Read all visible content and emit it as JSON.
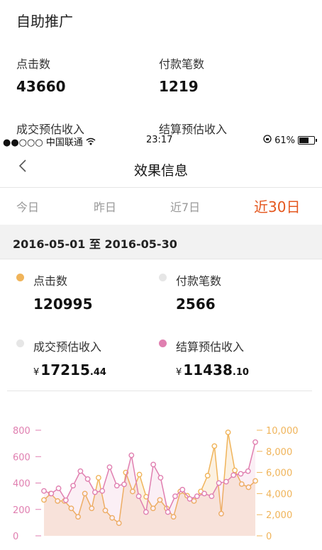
{
  "top_section": {
    "title": "自助推广",
    "clicks_label": "点击数",
    "clicks_value": "43660",
    "payments_label": "付款笔数",
    "payments_value": "1219",
    "deal_income_label": "成交预估收入",
    "settle_income_label": "结算预估收入"
  },
  "status_bar": {
    "signal": "●●○○○",
    "carrier": "中国联通",
    "time": "23:17",
    "battery": "61%"
  },
  "nav": {
    "back_icon": "chevron-left-icon",
    "title": "效果信息"
  },
  "tabs": [
    {
      "label": "今日"
    },
    {
      "label": "昨日"
    },
    {
      "label": "近7日"
    },
    {
      "label": "近30日"
    }
  ],
  "date_range": "2016-05-01 至 2016-05-30",
  "metrics": {
    "clicks": {
      "label": "点击数",
      "value": "120995",
      "color": "#f0b45a"
    },
    "payments": {
      "label": "付款笔数",
      "value": "2566",
      "color": "#e6e6e6"
    },
    "deal_income": {
      "label": "成交预估收入",
      "currency": "¥",
      "int": "17215",
      "dec": ".44",
      "color": "#e6e6e6"
    },
    "settle_income": {
      "label": "结算预估收入",
      "currency": "¥",
      "int": "11438",
      "dec": ".10",
      "color": "#e07fb0"
    }
  },
  "chart_data": {
    "type": "line",
    "left_axis": {
      "ticks": [
        "0",
        "200",
        "400",
        "600",
        "800"
      ],
      "ylim": [
        0,
        800
      ],
      "color": "#e07fb0"
    },
    "right_axis": {
      "ticks": [
        "0",
        "2,000",
        "4,000",
        "6,000",
        "8,000",
        "10,000"
      ],
      "ylim": [
        0,
        10000
      ],
      "color": "#f0b45a"
    },
    "series": [
      {
        "axis": "right",
        "color": "#f0b45a",
        "values": [
          3400,
          4000,
          3300,
          3300,
          2600,
          1800,
          4000,
          2600,
          5500,
          2400,
          1700,
          1200,
          6000,
          4200,
          5800,
          3700,
          2600,
          3400,
          2600,
          1800,
          4200,
          3800,
          3300,
          4200,
          5700,
          8500,
          2100,
          9800,
          6200,
          4900,
          4600,
          5200
        ]
      },
      {
        "axis": "left",
        "color": "#e07fb0",
        "values": [
          340,
          320,
          360,
          270,
          380,
          490,
          430,
          330,
          340,
          520,
          380,
          390,
          610,
          300,
          180,
          540,
          440,
          180,
          300,
          350,
          280,
          300,
          320,
          300,
          400,
          410,
          460,
          470,
          490,
          710
        ]
      }
    ]
  }
}
